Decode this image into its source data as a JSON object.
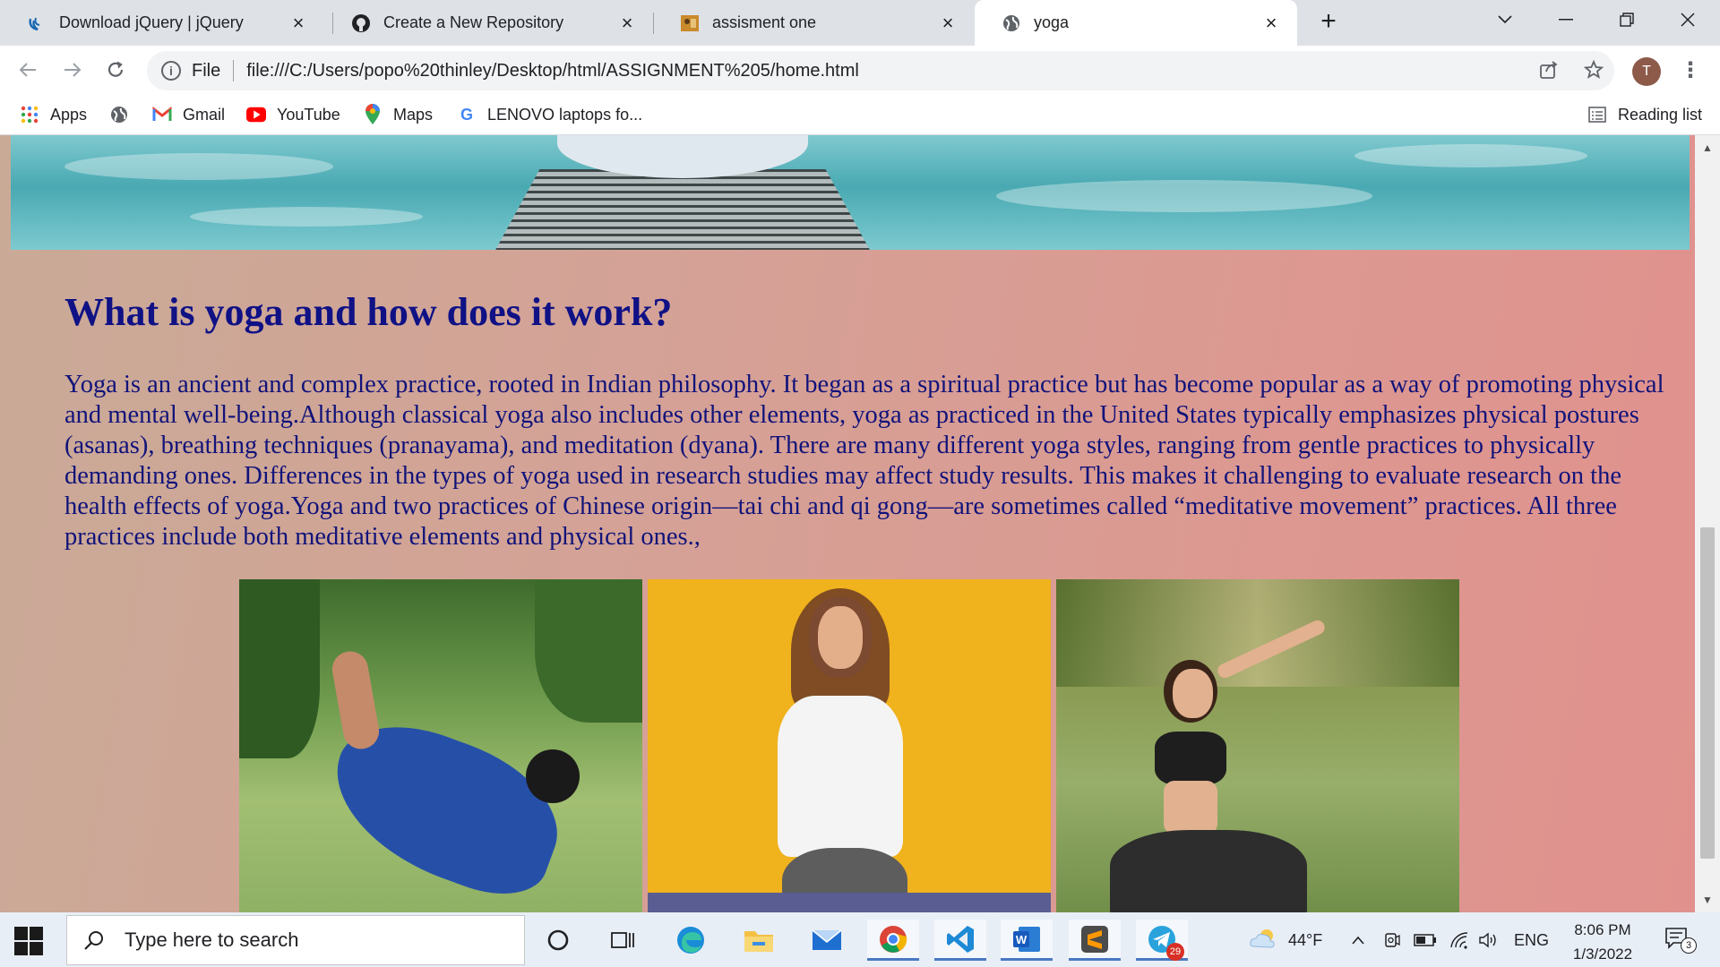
{
  "browser": {
    "tabs": [
      {
        "title": "Download jQuery | jQuery",
        "icon": "jquery-icon"
      },
      {
        "title": "Create a New Repository",
        "icon": "github-icon"
      },
      {
        "title": "assisment one",
        "icon": "page-image-icon"
      },
      {
        "title": "yoga",
        "icon": "globe-icon",
        "active": true
      }
    ],
    "file_label": "File",
    "url": "file:///C:/Users/popo%20thinley/Desktop/html/ASSIGNMENT%205/home.html",
    "profile_initial": "T",
    "bookmarks": [
      {
        "label": "Apps",
        "icon": "apps-grid-icon"
      },
      {
        "label": "",
        "icon": "globe-icon"
      },
      {
        "label": "Gmail",
        "icon": "gmail-icon"
      },
      {
        "label": "YouTube",
        "icon": "youtube-icon"
      },
      {
        "label": "Maps",
        "icon": "maps-pin-icon"
      },
      {
        "label": "LENOVO laptops fo...",
        "icon": "google-icon"
      }
    ],
    "reading_list": "Reading list"
  },
  "page": {
    "heading": "What is yoga and how does it work?",
    "paragraph": "Yoga is an ancient and complex practice, rooted in Indian philosophy. It began as a spiritual practice but has become popular as a way of promoting physical and mental well-being.Although classical yoga also includes other elements, yoga as practiced in the United States typically emphasizes physical postures (asanas), breathing techniques (pranayama), and meditation (dyana). There are many different yoga styles, ranging from gentle practices to physically demanding ones. Differences in the types of yoga used in research studies may affect study results. This makes it challenging to evaluate research on the health effects of yoga.Yoga and two practices of Chinese origin—tai chi and qi gong—are sometimes called “meditative movement” practices. All three practices include both meditative elements and physical ones.,"
  },
  "taskbar": {
    "search_placeholder": "Type here to search",
    "weather": "44°F",
    "language": "ENG",
    "time": "8:06 PM",
    "date": "1/3/2022",
    "telegram_badge": "29",
    "notification_badge": "3"
  },
  "colors": {
    "heading": "#0f1185",
    "text": "#11137a",
    "page_gradient_start": "#c9aa97",
    "page_gradient_end": "#e1918d"
  }
}
